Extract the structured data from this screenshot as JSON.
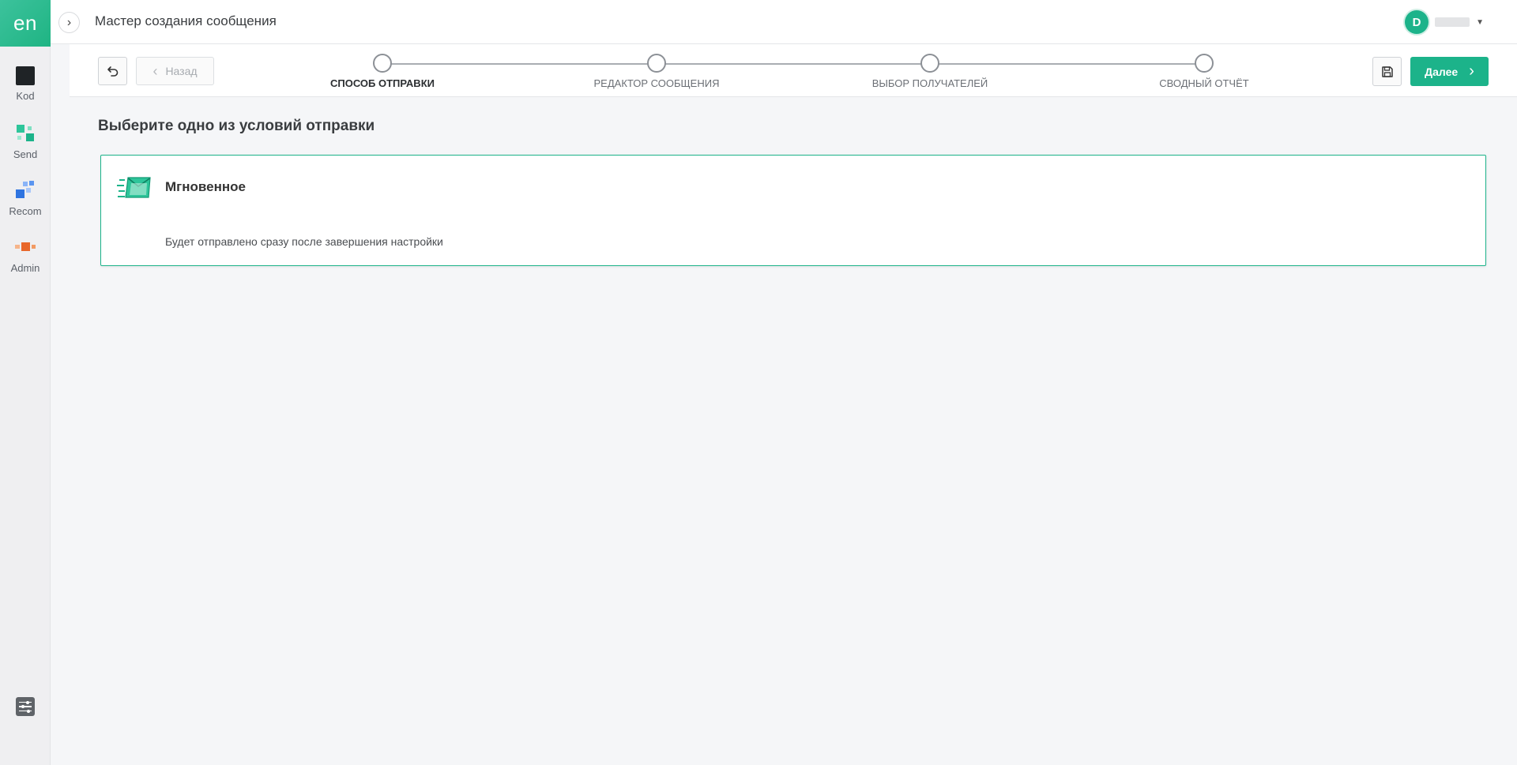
{
  "app": {
    "brand": "en",
    "page_title": "Мастер создания сообщения"
  },
  "rail": {
    "items": [
      {
        "label": "Kod",
        "icon": "kod-icon"
      },
      {
        "label": "Send",
        "icon": "send-icon"
      },
      {
        "label": "Recom",
        "icon": "recom-icon"
      },
      {
        "label": "Admin",
        "icon": "admin-icon"
      }
    ],
    "settings_icon": "settings-sliders-icon"
  },
  "user": {
    "initial": "D",
    "avatar_color": "#1cb38a"
  },
  "toolbar": {
    "back_label": "Назад",
    "next_label": "Далее",
    "accent": "#1cb38a"
  },
  "steps": [
    {
      "label": "СПОСОБ ОТПРАВКИ",
      "active": true
    },
    {
      "label": "РЕДАКТОР СООБЩЕНИЯ",
      "active": false
    },
    {
      "label": "ВЫБОР ПОЛУЧАТЕЛЕЙ",
      "active": false
    },
    {
      "label": "СВОДНЫЙ ОТЧЁТ",
      "active": false
    }
  ],
  "main": {
    "section_title": "Выберите одно из условий отправки",
    "options": [
      {
        "title": "Мгновенное",
        "description": "Будет отправлено сразу после завершения настройки",
        "icon": "instant-mail-icon",
        "selected": true
      }
    ]
  }
}
